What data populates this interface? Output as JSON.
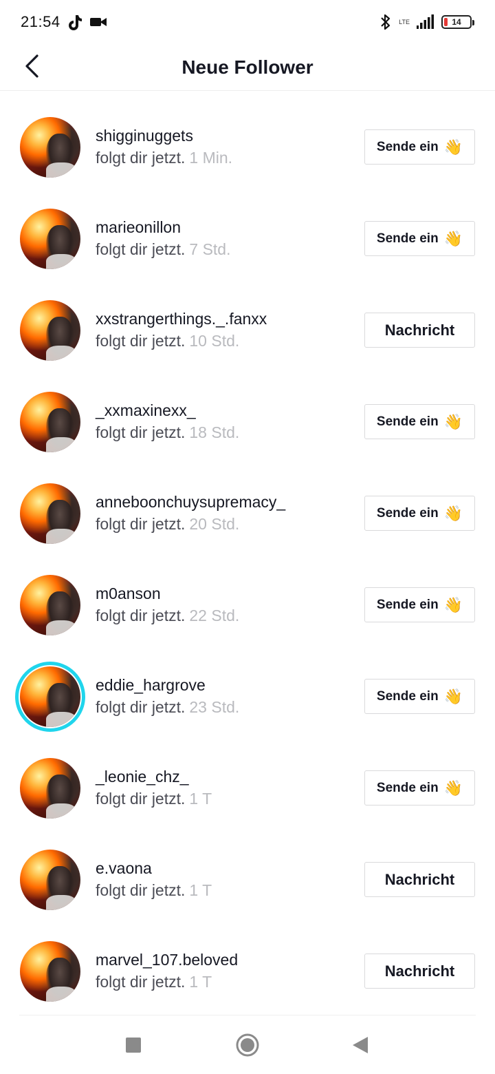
{
  "status_bar": {
    "time": "21:54",
    "network": "LTE",
    "battery": "14",
    "icons": [
      "tiktok-icon",
      "video-camera-icon",
      "bluetooth-icon",
      "signal-icon",
      "battery-icon"
    ]
  },
  "header": {
    "title": "Neue Follower",
    "back_icon": "chevron-left-icon"
  },
  "followers": [
    {
      "username": "shigginuggets",
      "subtitle": "folgt dir jetzt.",
      "time": "1 Min.",
      "action": "Sende ein",
      "action_type": "wave"
    },
    {
      "username": "marieonillon",
      "subtitle": "folgt dir jetzt.",
      "time": "7 Std.",
      "action": "Sende ein",
      "action_type": "wave"
    },
    {
      "username": "xxstrangerthings._.fanxx",
      "subtitle": "folgt dir jetzt.",
      "time": "10 Std.",
      "action": "Nachricht",
      "action_type": "message"
    },
    {
      "username": "_xxmaxinexx_",
      "subtitle": "folgt dir jetzt.",
      "time": "18 Std.",
      "action": "Sende ein",
      "action_type": "wave"
    },
    {
      "username": "anneboonchuysupremacy_",
      "subtitle": "folgt dir jetzt.",
      "time": "20 Std.",
      "action": "Sende ein",
      "action_type": "wave"
    },
    {
      "username": "m0anson",
      "subtitle": "folgt dir jetzt.",
      "time": "22 Std.",
      "action": "Sende ein",
      "action_type": "wave"
    },
    {
      "username": "eddie_hargrove",
      "subtitle": "folgt dir jetzt.",
      "time": "23 Std.",
      "action": "Sende ein",
      "action_type": "wave",
      "story_ring": true
    },
    {
      "username": "_leonie_chz_",
      "subtitle": "folgt dir jetzt.",
      "time": "1 T",
      "action": "Sende ein",
      "action_type": "wave"
    },
    {
      "username": "e.vaona",
      "subtitle": "folgt dir jetzt.",
      "time": "1 T",
      "action": "Nachricht",
      "action_type": "message"
    },
    {
      "username": "marvel_107.beloved",
      "subtitle": "folgt dir jetzt.",
      "time": "1 T",
      "action": "Nachricht",
      "action_type": "message"
    }
  ],
  "wave_emoji": "👋",
  "colors": {
    "story_ring": "#20d5ec",
    "time_text": "#b9babe",
    "button_border": "#d9d9db",
    "battery_low": "#e53935"
  },
  "nav_bar": {
    "icons": [
      "recent-apps-icon",
      "home-icon",
      "back-icon"
    ]
  }
}
